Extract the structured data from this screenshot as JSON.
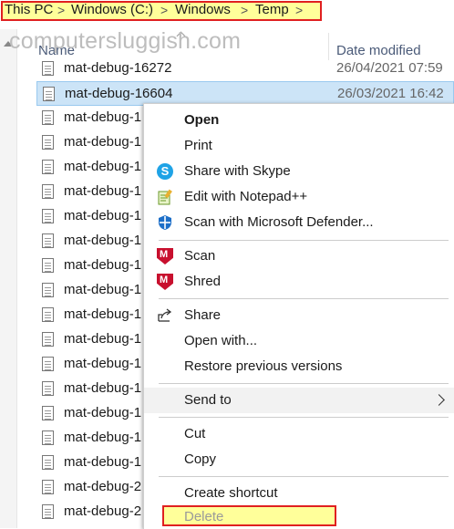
{
  "breadcrumb": {
    "items": [
      "This PC",
      "Windows (C:)",
      "Windows",
      "Temp"
    ],
    "separator": ">"
  },
  "watermark": "computersluggish.com",
  "columns": {
    "name": "Name",
    "date_modified": "Date modified"
  },
  "files": [
    {
      "name": "mat-debug-16272",
      "date": "26/04/2021 07:59"
    },
    {
      "name": "mat-debug-16604",
      "date": "26/03/2021 16:42",
      "selected": true
    },
    {
      "name": "mat-debug-1"
    },
    {
      "name": "mat-debug-1"
    },
    {
      "name": "mat-debug-1"
    },
    {
      "name": "mat-debug-1"
    },
    {
      "name": "mat-debug-1"
    },
    {
      "name": "mat-debug-1"
    },
    {
      "name": "mat-debug-1"
    },
    {
      "name": "mat-debug-1"
    },
    {
      "name": "mat-debug-1"
    },
    {
      "name": "mat-debug-1"
    },
    {
      "name": "mat-debug-1"
    },
    {
      "name": "mat-debug-1"
    },
    {
      "name": "mat-debug-1"
    },
    {
      "name": "mat-debug-1"
    },
    {
      "name": "mat-debug-1"
    },
    {
      "name": "mat-debug-2"
    },
    {
      "name": "mat-debug-2"
    }
  ],
  "context_menu": {
    "open": "Open",
    "print": "Print",
    "share_skype": "Share with Skype",
    "edit_notepad": "Edit with Notepad++",
    "scan_defender": "Scan with Microsoft Defender...",
    "scan": "Scan",
    "shred": "Shred",
    "share": "Share",
    "open_with": "Open with...",
    "restore": "Restore previous versions",
    "send_to": "Send to",
    "cut": "Cut",
    "copy": "Copy",
    "create_shortcut": "Create shortcut",
    "delete": "Delete"
  },
  "icons": {
    "skype": "skype-icon",
    "notepad": "notepad-plus-plus-icon",
    "defender": "defender-shield-icon",
    "mcafee": "mcafee-icon",
    "share": "share-icon"
  },
  "colors": {
    "highlight_fill": "#ffff9a",
    "highlight_border": "#e02020",
    "selection": "#cce4f7"
  }
}
